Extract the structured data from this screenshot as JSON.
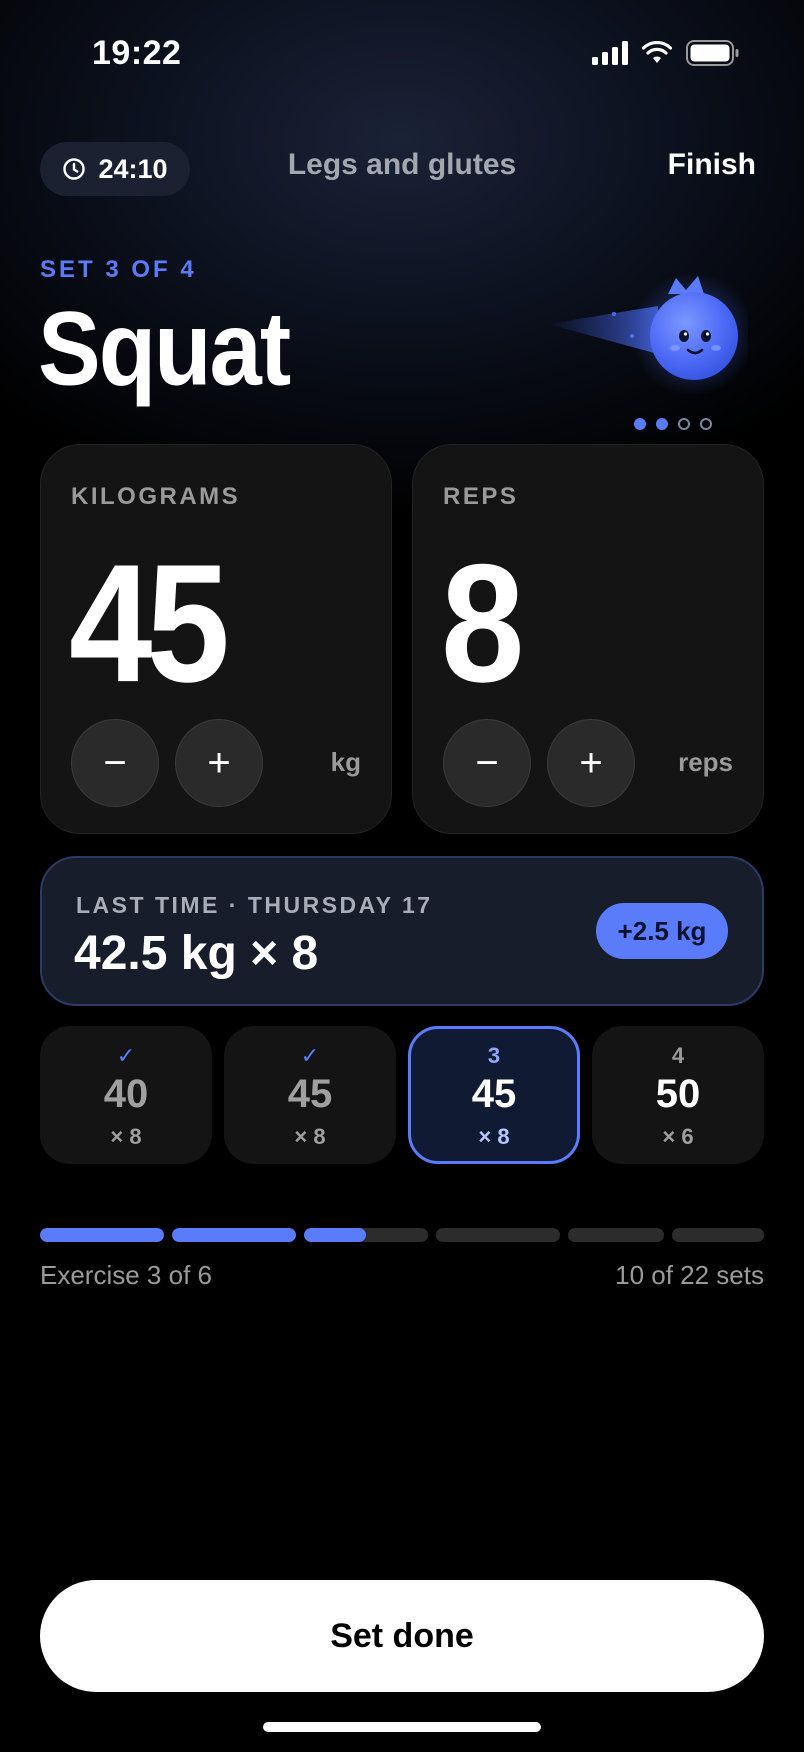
{
  "status_bar": {
    "time": "19:22"
  },
  "header": {
    "timer": "24:10",
    "workout_title": "Legs and glutes",
    "finish_label": "Finish"
  },
  "exercise": {
    "set_label": "SET 3 OF 4",
    "name": "Squat",
    "page_dots": {
      "total": 4,
      "active": 2
    }
  },
  "weight_card": {
    "label": "KILOGRAMS",
    "value": "45",
    "unit": "kg",
    "minus": "−",
    "plus": "+"
  },
  "reps_card": {
    "label": "REPS",
    "value": "8",
    "unit": "reps",
    "minus": "−",
    "plus": "+"
  },
  "last_time": {
    "label": "LAST TIME · THURSDAY 17",
    "value": "42.5 kg × 8",
    "badge": "+2.5 kg"
  },
  "sets": [
    {
      "top": "✓",
      "weight": "40",
      "reps": "× 8",
      "state": "done"
    },
    {
      "top": "✓",
      "weight": "45",
      "reps": "× 8",
      "state": "done"
    },
    {
      "top": "3",
      "weight": "45",
      "reps": "× 8",
      "state": "active"
    },
    {
      "top": "4",
      "weight": "50",
      "reps": "× 6",
      "state": "upcoming"
    }
  ],
  "progress": {
    "exercise_text": "Exercise 3 of 6",
    "sets_text": "10 of 22 sets",
    "segments_fill": [
      1,
      1,
      0.5,
      0,
      0,
      0
    ]
  },
  "primary_action": {
    "label": "Set done"
  },
  "colors": {
    "accent": "#5b7cfa",
    "background": "#000000",
    "card": "#141414"
  }
}
